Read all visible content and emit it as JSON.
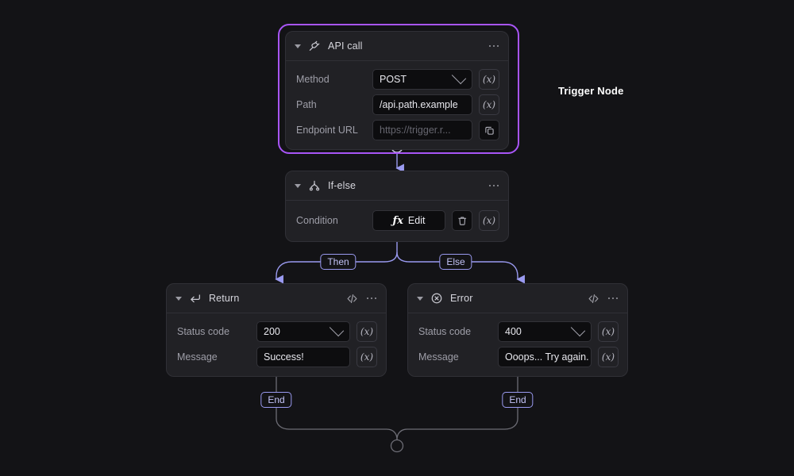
{
  "canvas": {
    "bg_color": "#131316",
    "selection_color": "#a855f7",
    "edge_color": "#9a9af0",
    "edge_color_muted": "#6d6d75"
  },
  "annotations": [
    {
      "text": "Trigger Node"
    }
  ],
  "nodes": {
    "api_call": {
      "title": "API call",
      "icon": "plug-icon",
      "selected": true,
      "rows": [
        {
          "label": "Method",
          "value": "POST",
          "placeholder": "",
          "control": "select",
          "action": "(x)"
        },
        {
          "label": "Path",
          "value": "/api.path.example",
          "placeholder": "",
          "control": "text",
          "action": "(x)"
        },
        {
          "label": "Endpoint URL",
          "value": "",
          "placeholder": "https://trigger.r...",
          "control": "text",
          "action": "copy-icon"
        }
      ]
    },
    "if_else": {
      "title": "If-else",
      "icon": "branch-icon",
      "rows": [
        {
          "label": "Condition",
          "button": "Edit",
          "button_icon": "fx-icon",
          "action_delete": "trash-icon",
          "action": "(x)"
        }
      ]
    },
    "return": {
      "title": "Return",
      "icon": "return-arrow-icon",
      "head_actions": [
        "code-icon",
        "more-icon"
      ],
      "rows": [
        {
          "label": "Status code",
          "value": "200",
          "control": "select",
          "action": "(x)"
        },
        {
          "label": "Message",
          "value": "Success!",
          "control": "text",
          "action": "(x)"
        }
      ]
    },
    "error": {
      "title": "Error",
      "icon": "circle-x-icon",
      "head_actions": [
        "code-icon",
        "more-icon"
      ],
      "rows": [
        {
          "label": "Status code",
          "value": "400",
          "control": "select",
          "action": "(x)"
        },
        {
          "label": "Message",
          "value": "Ooops... Try again.",
          "control": "text",
          "action": "(x)"
        }
      ]
    }
  },
  "edge_labels": {
    "then": "Then",
    "else": "Else",
    "end_left": "End",
    "end_right": "End"
  }
}
